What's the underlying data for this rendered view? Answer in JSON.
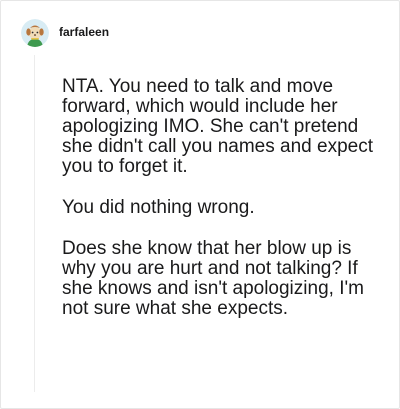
{
  "comment": {
    "author": {
      "username": "farfaleen",
      "avatar_icon": "dog-avatar-icon"
    },
    "paragraphs": [
      "NTA. You need to talk and move forward, which would include her apologizing IMO. She can't pretend she didn't call you names and expect you to forget it.",
      "You did nothing wrong.",
      "Does she know that her blow up is why you are hurt and not talking? If she knows and isn't apologizing, I'm not sure what she expects."
    ]
  },
  "colors": {
    "text": "#1a1a1b",
    "thread_line": "#ececec",
    "card_border": "#e6e6e6"
  }
}
